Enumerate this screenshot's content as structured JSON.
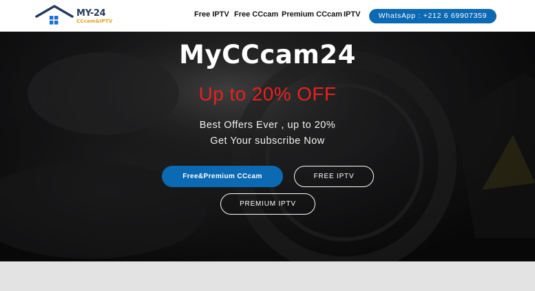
{
  "colors": {
    "brand_blue": "#0c69b3",
    "offer_red": "#e8211f",
    "logo_navy": "#23395d",
    "logo_orange": "#e6a118"
  },
  "logo": {
    "icon": "house-icon",
    "title": "MY-24",
    "subtitle": "CCcam&IPTV"
  },
  "nav": {
    "items": [
      {
        "label": "Free IPTV"
      },
      {
        "label": "Free CCcam"
      },
      {
        "label": "Premium CCcam"
      },
      {
        "label": "IPTV"
      }
    ],
    "whatsapp_label": "WhatsApp : +212 6 69907359"
  },
  "hero": {
    "title": "MyCCcam24",
    "offer": "Up to 20% OFF",
    "line1": "Best Offers Ever , up to 20%",
    "line2": "Get Your subscribe Now",
    "buttons": [
      {
        "label": "Free&Premium CCcam"
      },
      {
        "label": "FREE IPTV"
      },
      {
        "label": "PREMIUM IPTV"
      }
    ]
  }
}
